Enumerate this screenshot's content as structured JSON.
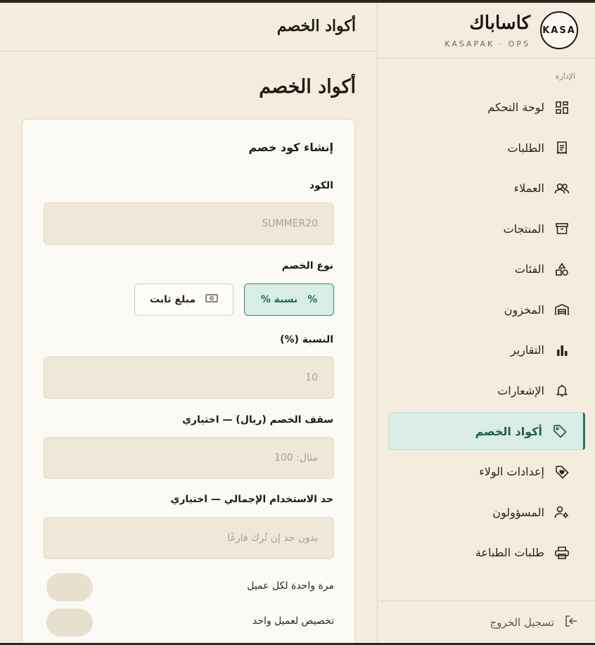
{
  "brand": {
    "logo_text": "KASA",
    "name": "كاساباك",
    "subtitle": "KASAPAK · OPS"
  },
  "sidebar": {
    "section_label": "الإدارة",
    "items": [
      {
        "label": "لوحة التحكم",
        "icon": "dashboard-icon"
      },
      {
        "label": "الطلبات",
        "icon": "receipt-icon"
      },
      {
        "label": "العملاء",
        "icon": "users-icon"
      },
      {
        "label": "المنتجات",
        "icon": "archive-icon"
      },
      {
        "label": "الفئات",
        "icon": "shapes-icon"
      },
      {
        "label": "المخزون",
        "icon": "warehouse-icon"
      },
      {
        "label": "التقارير",
        "icon": "bar-chart-icon"
      },
      {
        "label": "الإشعارات",
        "icon": "bell-icon"
      },
      {
        "label": "أكواد الخصم",
        "icon": "tag-icon",
        "active": true
      },
      {
        "label": "إعدادات الولاء",
        "icon": "heart-tag-icon"
      },
      {
        "label": "المسؤولون",
        "icon": "user-gear-icon"
      },
      {
        "label": "طلبات الطباعة",
        "icon": "printer-icon"
      }
    ],
    "logout_label": "تسجيل الخروج"
  },
  "topbar": {
    "title": "أكواد الخصم"
  },
  "page": {
    "title": "أكواد الخصم"
  },
  "form": {
    "title": "إنشاء كود خصم",
    "code_label": "الكود",
    "code_placeholder": "SUMMER20",
    "type_label": "نوع الخصم",
    "type_percent_label": "نسبة %",
    "type_fixed_label": "مبلغ ثابت",
    "percent_label": "النسبة (%)",
    "percent_value": "10",
    "cap_label": "سقف الخصم (ريال) — اختياري",
    "cap_placeholder": "مثال: 100",
    "limit_label": "حد الاستخدام الإجمالي — اختياري",
    "limit_placeholder": "بدون حد إن تُرك فارغًا",
    "once_per_customer_label": "مرة واحدة لكل عميل",
    "single_customer_label": "تخصيص لعميل واحد"
  },
  "colors": {
    "accent": "#1e7a68",
    "active_bg": "#d9ece6",
    "background": "#f4eddf"
  }
}
